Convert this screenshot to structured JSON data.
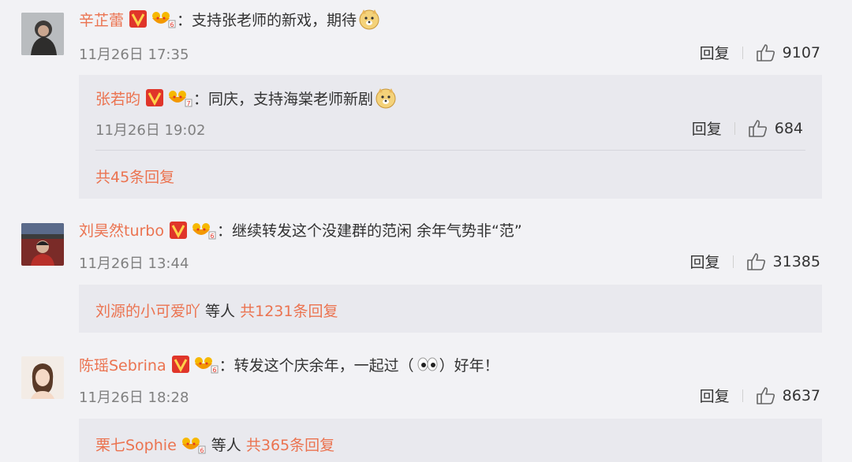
{
  "comments": [
    {
      "name": "辛芷蕾",
      "text": "：支持张老师的新戏，期待",
      "time": "11月26日 17:35",
      "reply_label": "回复",
      "likes": "9107",
      "avatar": "avatar-dark",
      "reply": {
        "name": "张若昀",
        "text": "：同庆，支持海棠老师新剧",
        "time": "11月26日 19:02",
        "reply_label": "回复",
        "likes": "684",
        "more": "共45条回复"
      }
    },
    {
      "name": "刘昊然turbo",
      "text": "：继续转发这个没建群的范闲 余年气势非“范”",
      "time": "11月26日 13:44",
      "reply_label": "回复",
      "likes": "31385",
      "more_user": "刘源的小可爱吖",
      "more_mid": " 等人 ",
      "more_count": "共1231条回复"
    },
    {
      "name": "陈瑶Sebrina",
      "text_before": "：转发这个庆余年，一起过（",
      "text_after": "）好年！",
      "time": "11月26日 18:28",
      "reply_label": "回复",
      "likes": "8637",
      "more_user": "栗七Sophie",
      "more_mid": " 等人 ",
      "more_count": "共365条回复"
    }
  ],
  "colors": {
    "name": "#eb7350",
    "background": "#f2f2f5",
    "reply_box": "#e9e9ee",
    "vip": "#e0352a"
  },
  "icons": [
    "verified-v-icon",
    "vip-crown-icon",
    "thumbs-up-icon",
    "doge-emoji",
    "eyes-emoji"
  ]
}
